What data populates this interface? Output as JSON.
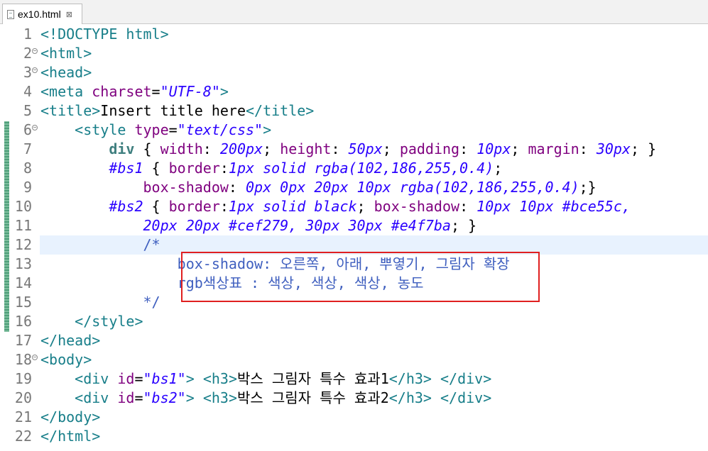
{
  "tab": {
    "filename": "ex10.html",
    "close_symbol": "⊠"
  },
  "lines": [
    {
      "n": "1",
      "segments": [
        {
          "t": "<!DOCTYPE html>",
          "c": "tag"
        }
      ]
    },
    {
      "n": "2",
      "fold": true,
      "segments": [
        {
          "t": "<html>",
          "c": "tag"
        }
      ]
    },
    {
      "n": "3",
      "fold": true,
      "segments": [
        {
          "t": "<head>",
          "c": "tag"
        }
      ]
    },
    {
      "n": "4",
      "segments": [
        {
          "t": "<meta ",
          "c": "tag"
        },
        {
          "t": "charset",
          "c": "attr"
        },
        {
          "t": "=",
          "c": "txt"
        },
        {
          "t": "\"UTF-8\"",
          "c": "str"
        },
        {
          "t": ">",
          "c": "tag"
        }
      ]
    },
    {
      "n": "5",
      "segments": [
        {
          "t": "<title>",
          "c": "tag"
        },
        {
          "t": "Insert title here",
          "c": "txt"
        },
        {
          "t": "</title>",
          "c": "tag"
        }
      ]
    },
    {
      "n": "6",
      "fold": true,
      "segments": [
        {
          "t": "    <style ",
          "c": "tag"
        },
        {
          "t": "type",
          "c": "attr"
        },
        {
          "t": "=",
          "c": "txt"
        },
        {
          "t": "\"text/css\"",
          "c": "str"
        },
        {
          "t": ">",
          "c": "tag"
        }
      ]
    },
    {
      "n": "7",
      "segments": [
        {
          "t": "        ",
          "c": "txt"
        },
        {
          "t": "div",
          "c": "sel"
        },
        {
          "t": " { ",
          "c": "txt"
        },
        {
          "t": "width",
          "c": "prop"
        },
        {
          "t": ": ",
          "c": "txt"
        },
        {
          "t": "200px",
          "c": "val"
        },
        {
          "t": "; ",
          "c": "txt"
        },
        {
          "t": "height",
          "c": "prop"
        },
        {
          "t": ": ",
          "c": "txt"
        },
        {
          "t": "50px",
          "c": "val"
        },
        {
          "t": "; ",
          "c": "txt"
        },
        {
          "t": "padding",
          "c": "prop"
        },
        {
          "t": ": ",
          "c": "txt"
        },
        {
          "t": "10px",
          "c": "val"
        },
        {
          "t": "; ",
          "c": "txt"
        },
        {
          "t": "margin",
          "c": "prop"
        },
        {
          "t": ": ",
          "c": "txt"
        },
        {
          "t": "30px",
          "c": "val"
        },
        {
          "t": "; }",
          "c": "txt"
        }
      ]
    },
    {
      "n": "8",
      "segments": [
        {
          "t": "        ",
          "c": "txt"
        },
        {
          "t": "#bs1",
          "c": "val"
        },
        {
          "t": " { ",
          "c": "txt"
        },
        {
          "t": "border",
          "c": "prop"
        },
        {
          "t": ":",
          "c": "txt"
        },
        {
          "t": "1px solid rgba(102,186,255,0.4)",
          "c": "val"
        },
        {
          "t": ";",
          "c": "txt"
        }
      ]
    },
    {
      "n": "9",
      "segments": [
        {
          "t": "            ",
          "c": "txt"
        },
        {
          "t": "box-shadow",
          "c": "prop"
        },
        {
          "t": ": ",
          "c": "txt"
        },
        {
          "t": "0px 0px 20px 10px rgba(102,186,255,0.4)",
          "c": "val"
        },
        {
          "t": ";}",
          "c": "txt"
        }
      ]
    },
    {
      "n": "10",
      "segments": [
        {
          "t": "        ",
          "c": "txt"
        },
        {
          "t": "#bs2",
          "c": "val"
        },
        {
          "t": " { ",
          "c": "txt"
        },
        {
          "t": "border",
          "c": "prop"
        },
        {
          "t": ":",
          "c": "txt"
        },
        {
          "t": "1px solid black",
          "c": "val"
        },
        {
          "t": "; ",
          "c": "txt"
        },
        {
          "t": "box-shadow",
          "c": "prop"
        },
        {
          "t": ": ",
          "c": "txt"
        },
        {
          "t": "10px 10px #bce55c,",
          "c": "val"
        }
      ]
    },
    {
      "n": "11",
      "segments": [
        {
          "t": "            ",
          "c": "txt"
        },
        {
          "t": "20px 20px #cef279, 30px 30px #e4f7ba",
          "c": "val"
        },
        {
          "t": "; }",
          "c": "txt"
        }
      ]
    },
    {
      "n": "12",
      "segments": [
        {
          "t": "            /*",
          "c": "cm"
        }
      ]
    },
    {
      "n": "13",
      "segments": [
        {
          "t": "                box-shadow: 오른쪽, 아래, 뿌옇기, 그림자 확장",
          "c": "cm"
        }
      ]
    },
    {
      "n": "14",
      "segments": [
        {
          "t": "                rgb색상표 : 색상, 색상, 색상, 농도",
          "c": "cm"
        }
      ]
    },
    {
      "n": "15",
      "segments": [
        {
          "t": "            */",
          "c": "cm"
        }
      ]
    },
    {
      "n": "16",
      "segments": [
        {
          "t": "    </style>",
          "c": "tag"
        }
      ]
    },
    {
      "n": "17",
      "segments": [
        {
          "t": "</head>",
          "c": "tag"
        }
      ]
    },
    {
      "n": "18",
      "fold": true,
      "segments": [
        {
          "t": "<body>",
          "c": "tag"
        }
      ]
    },
    {
      "n": "19",
      "segments": [
        {
          "t": "    <div ",
          "c": "tag"
        },
        {
          "t": "id",
          "c": "attr"
        },
        {
          "t": "=",
          "c": "txt"
        },
        {
          "t": "\"bs1\"",
          "c": "str"
        },
        {
          "t": "> <h3>",
          "c": "tag"
        },
        {
          "t": "박스 그림자 특수 효과1",
          "c": "txt"
        },
        {
          "t": "</h3> </div>",
          "c": "tag"
        }
      ]
    },
    {
      "n": "20",
      "segments": [
        {
          "t": "    <div ",
          "c": "tag"
        },
        {
          "t": "id",
          "c": "attr"
        },
        {
          "t": "=",
          "c": "txt"
        },
        {
          "t": "\"bs2\"",
          "c": "str"
        },
        {
          "t": "> <h3>",
          "c": "tag"
        },
        {
          "t": "박스 그림자 특수 효과2",
          "c": "txt"
        },
        {
          "t": "</h3> </div>",
          "c": "tag"
        }
      ]
    },
    {
      "n": "21",
      "segments": [
        {
          "t": "</body>",
          "c": "tag"
        }
      ]
    },
    {
      "n": "22",
      "segments": [
        {
          "t": "</html>",
          "c": "tag"
        }
      ]
    }
  ]
}
